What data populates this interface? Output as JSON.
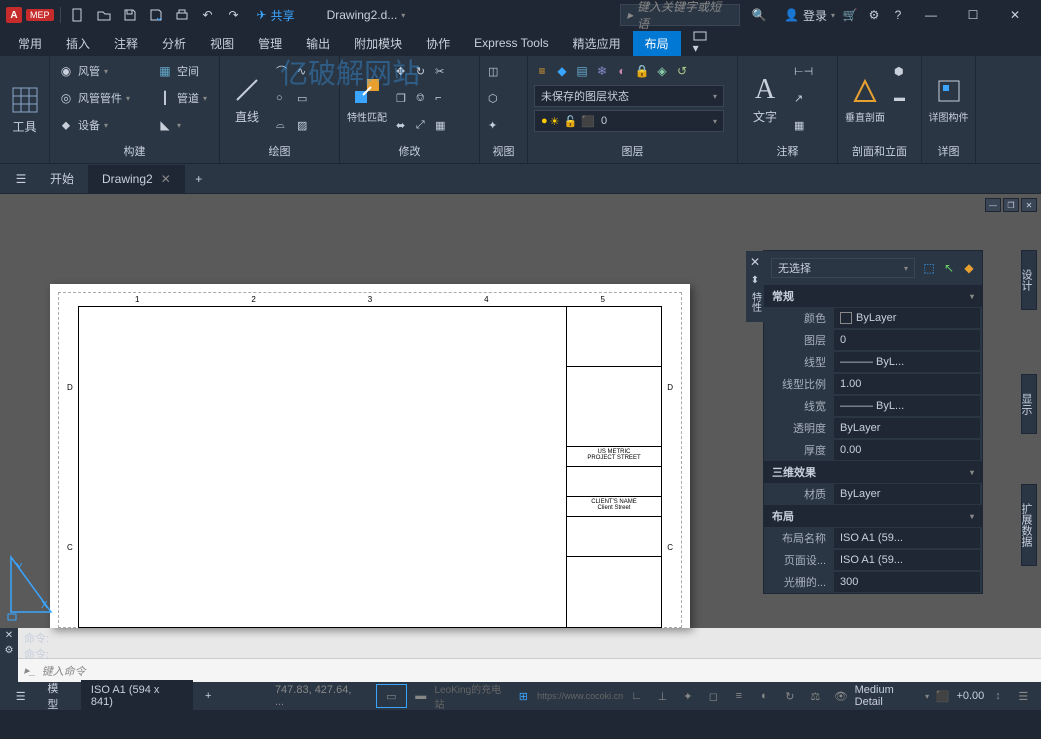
{
  "app": {
    "name": "A",
    "edition": "MEP",
    "document": "Drawing2.d...",
    "share": "共享",
    "search_placeholder": "键入关键字或短语",
    "login": "登录"
  },
  "menu": {
    "tabs": [
      "常用",
      "插入",
      "注释",
      "分析",
      "视图",
      "管理",
      "输出",
      "附加模块",
      "协作",
      "Express Tools",
      "精选应用",
      "布局"
    ],
    "active": 11
  },
  "ribbon": {
    "panels": [
      {
        "title": "工具"
      },
      {
        "title": "构建",
        "items": [
          "风管",
          "风管管件",
          "设备",
          "空间",
          "管道"
        ]
      },
      {
        "title": "绘图",
        "btn": "直线"
      },
      {
        "title": "修改",
        "btn": "特性匹配"
      },
      {
        "title": "视图"
      },
      {
        "title": "图层",
        "unsaved": "未保存的图层状态",
        "current": "0"
      },
      {
        "title": "注释",
        "btn": "文字"
      },
      {
        "title": "剖面和立面",
        "btn": "垂直剖面"
      },
      {
        "title": "详图",
        "btn": "详图构件"
      }
    ]
  },
  "doctabs": {
    "start": "开始",
    "tabs": [
      "Drawing2"
    ],
    "active": 0
  },
  "props": {
    "selection": "无选择",
    "sections": [
      {
        "name": "常规",
        "rows": [
          {
            "k": "颜色",
            "v": "ByLayer"
          },
          {
            "k": "图层",
            "v": "0"
          },
          {
            "k": "线型",
            "v": "——— ByL..."
          },
          {
            "k": "线型比例",
            "v": "1.00"
          },
          {
            "k": "线宽",
            "v": "——— ByL..."
          },
          {
            "k": "透明度",
            "v": "ByLayer"
          },
          {
            "k": "厚度",
            "v": "0.00"
          }
        ]
      },
      {
        "name": "三维效果",
        "rows": [
          {
            "k": "材质",
            "v": "ByLayer"
          }
        ]
      },
      {
        "name": "布局",
        "rows": [
          {
            "k": "布局名称",
            "v": "ISO A1 (59..."
          },
          {
            "k": "页面设...",
            "v": "ISO A1 (59..."
          },
          {
            "k": "光栅的...",
            "v": "300"
          }
        ]
      }
    ]
  },
  "sidetabs": [
    "设计",
    "显示",
    "扩展数据"
  ],
  "cmd": {
    "prompt": "命令:",
    "input_placeholder": "键入命令"
  },
  "status": {
    "model": "模型",
    "layout": "ISO A1 (594 x 841)",
    "coords": "747.83, 427.64, ...",
    "detail": "Medium Detail",
    "offset": "+0.00",
    "url": "https://www.cocoki.cn",
    "credit": "LeoKing的充电站"
  },
  "titleblock": {
    "l1": "US METRIC",
    "l2": "PROJECT STREET",
    "l3": "CLIENT'S NAME",
    "l4": "Client Street"
  },
  "watermark": "亿破解网站"
}
